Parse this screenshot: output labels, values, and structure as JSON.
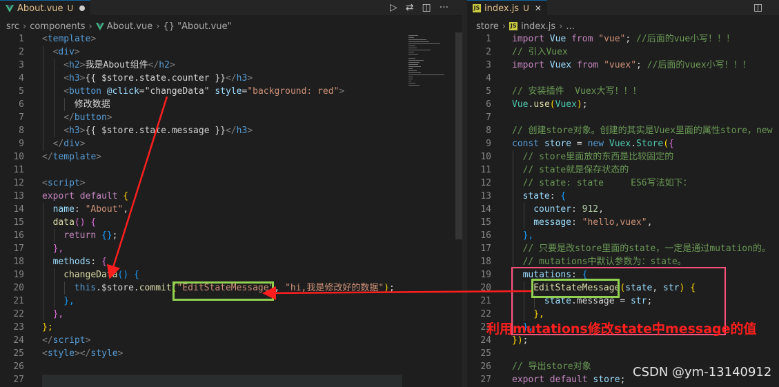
{
  "left": {
    "tab": {
      "label": "About.vue",
      "status": "U"
    },
    "breadcrumb": [
      "src",
      "components",
      "About.vue",
      "{} \"About.vue\""
    ],
    "lines": [
      {
        "n": "1",
        "i": 0,
        "s": [
          [
            "<",
            "k-gray"
          ],
          [
            "template",
            "k-tag"
          ],
          [
            ">",
            "k-gray"
          ]
        ]
      },
      {
        "n": "2",
        "i": 1,
        "s": [
          [
            "<",
            "k-gray"
          ],
          [
            "div",
            "k-tag"
          ],
          [
            ">",
            "k-gray"
          ]
        ]
      },
      {
        "n": "3",
        "i": 2,
        "s": [
          [
            "<",
            "k-gray"
          ],
          [
            "h2",
            "k-tag"
          ],
          [
            ">",
            "k-gray"
          ],
          [
            "我是About组件",
            "k-txt"
          ],
          [
            "</",
            "k-gray"
          ],
          [
            "h2",
            "k-tag"
          ],
          [
            ">",
            "k-gray"
          ]
        ]
      },
      {
        "n": "4",
        "i": 2,
        "s": [
          [
            "<",
            "k-gray"
          ],
          [
            "h3",
            "k-tag"
          ],
          [
            ">",
            "k-gray"
          ],
          [
            "{{ ",
            "k-txt"
          ],
          [
            "$store.state.counter",
            "k-txt"
          ],
          [
            " }}",
            "k-txt"
          ],
          [
            "</",
            "k-gray"
          ],
          [
            "h3",
            "k-tag"
          ],
          [
            ">",
            "k-gray"
          ]
        ]
      },
      {
        "n": "5",
        "i": 2,
        "s": [
          [
            "<",
            "k-gray"
          ],
          [
            "button",
            "k-tag"
          ],
          [
            " @click",
            "k-var"
          ],
          [
            "=",
            "k-txt"
          ],
          [
            "\"changeData\"",
            "k-txt"
          ],
          [
            " style",
            "k-var"
          ],
          [
            "=",
            "k-txt"
          ],
          [
            "\"background: red\"",
            "k-str"
          ],
          [
            ">",
            "k-gray"
          ]
        ]
      },
      {
        "n": "6",
        "i": 3,
        "s": [
          [
            "修改数据",
            "k-txt"
          ]
        ]
      },
      {
        "n": "7",
        "i": 2,
        "s": [
          [
            "</",
            "k-gray"
          ],
          [
            "button",
            "k-tag"
          ],
          [
            ">",
            "k-gray"
          ]
        ]
      },
      {
        "n": "8",
        "i": 2,
        "s": [
          [
            "<",
            "k-gray"
          ],
          [
            "h3",
            "k-tag"
          ],
          [
            ">",
            "k-gray"
          ],
          [
            "{{ ",
            "k-txt"
          ],
          [
            "$store.state.message",
            "k-txt"
          ],
          [
            " }}",
            "k-txt"
          ],
          [
            "</",
            "k-gray"
          ],
          [
            "h3",
            "k-tag"
          ],
          [
            ">",
            "k-gray"
          ]
        ]
      },
      {
        "n": "9",
        "i": 1,
        "s": [
          [
            "</",
            "k-gray"
          ],
          [
            "div",
            "k-tag"
          ],
          [
            ">",
            "k-gray"
          ]
        ]
      },
      {
        "n": "10",
        "i": 0,
        "s": [
          [
            "</",
            "k-gray"
          ],
          [
            "template",
            "k-tag"
          ],
          [
            ">",
            "k-gray"
          ]
        ]
      },
      {
        "n": "11",
        "i": 0,
        "s": []
      },
      {
        "n": "12",
        "i": 0,
        "s": [
          [
            "<",
            "k-gray"
          ],
          [
            "script",
            "k-tag"
          ],
          [
            ">",
            "k-gray"
          ]
        ]
      },
      {
        "n": "13",
        "i": 0,
        "s": [
          [
            "export",
            "k-ctrl"
          ],
          [
            " ",
            "k-txt"
          ],
          [
            "default",
            "k-ctrl"
          ],
          [
            " ",
            "k-txt"
          ],
          [
            "{",
            "k-b1"
          ]
        ]
      },
      {
        "n": "14",
        "i": 1,
        "s": [
          [
            "name",
            "k-var"
          ],
          [
            ": ",
            "k-txt"
          ],
          [
            "\"About\"",
            "k-str"
          ],
          [
            ",",
            "k-txt"
          ]
        ]
      },
      {
        "n": "15",
        "i": 1,
        "s": [
          [
            "data",
            "k-fn"
          ],
          [
            "()",
            "k-b2"
          ],
          [
            " ",
            "k-txt"
          ],
          [
            "{",
            "k-b2"
          ]
        ]
      },
      {
        "n": "16",
        "i": 2,
        "s": [
          [
            "return",
            "k-ctrl"
          ],
          [
            " ",
            "k-txt"
          ],
          [
            "{}",
            "k-b3"
          ],
          [
            ";",
            "k-txt"
          ]
        ]
      },
      {
        "n": "17",
        "i": 1,
        "s": [
          [
            "},",
            "k-b2"
          ]
        ]
      },
      {
        "n": "18",
        "i": 1,
        "s": [
          [
            "methods",
            "k-var"
          ],
          [
            ": ",
            "k-txt"
          ],
          [
            "{",
            "k-b2"
          ]
        ]
      },
      {
        "n": "19",
        "i": 2,
        "s": [
          [
            "changeData",
            "k-fn"
          ],
          [
            "()",
            "k-b3"
          ],
          [
            " ",
            "k-txt"
          ],
          [
            "{",
            "k-b3"
          ]
        ]
      },
      {
        "n": "20",
        "i": 3,
        "s": [
          [
            "this",
            "k-tag"
          ],
          [
            ".$store.",
            "k-txt"
          ],
          [
            "commit",
            "k-fn"
          ],
          [
            "(",
            "k-b1"
          ],
          [
            "\"EditStateMessage\"",
            "k-str"
          ],
          [
            ", ",
            "k-txt"
          ],
          [
            "\"hi,我是修改好的数据\"",
            "k-str"
          ],
          [
            ")",
            "k-b1"
          ],
          [
            ";",
            "k-txt"
          ]
        ]
      },
      {
        "n": "21",
        "i": 2,
        "s": [
          [
            "},",
            "k-b3"
          ]
        ]
      },
      {
        "n": "22",
        "i": 1,
        "s": [
          [
            "},",
            "k-b2"
          ]
        ]
      },
      {
        "n": "23",
        "i": 0,
        "s": [
          [
            "};",
            "k-b1"
          ]
        ]
      },
      {
        "n": "24",
        "i": 0,
        "s": [
          [
            "</",
            "k-gray"
          ],
          [
            "script",
            "k-tag"
          ],
          [
            ">",
            "k-gray"
          ]
        ]
      },
      {
        "n": "25",
        "i": 0,
        "s": [
          [
            "<",
            "k-gray"
          ],
          [
            "style",
            "k-tag"
          ],
          [
            "></",
            "k-gray"
          ],
          [
            "style",
            "k-tag"
          ],
          [
            ">",
            "k-gray"
          ]
        ]
      },
      {
        "n": "26",
        "i": 0,
        "s": []
      },
      {
        "n": "27",
        "i": 0,
        "s": []
      }
    ]
  },
  "right": {
    "tab": {
      "label": "index.js",
      "status": "U"
    },
    "breadcrumb": [
      "store",
      "index.js",
      "..."
    ],
    "lines": [
      {
        "n": "1",
        "i": 0,
        "s": [
          [
            "import",
            "k-ctrl"
          ],
          [
            " ",
            "k-txt"
          ],
          [
            "Vue",
            "k-var"
          ],
          [
            " ",
            "k-txt"
          ],
          [
            "from",
            "k-ctrl"
          ],
          [
            " ",
            "k-txt"
          ],
          [
            "\"vue\"",
            "k-str"
          ],
          [
            "; ",
            "k-txt"
          ],
          [
            "//后面的vue小写！！！",
            "k-com"
          ]
        ]
      },
      {
        "n": "2",
        "i": 0,
        "s": [
          [
            "// 引入Vuex",
            "k-com"
          ]
        ]
      },
      {
        "n": "3",
        "i": 0,
        "s": [
          [
            "import",
            "k-ctrl"
          ],
          [
            " ",
            "k-txt"
          ],
          [
            "Vuex",
            "k-var"
          ],
          [
            " ",
            "k-txt"
          ],
          [
            "from",
            "k-ctrl"
          ],
          [
            " ",
            "k-txt"
          ],
          [
            "\"vuex\"",
            "k-str"
          ],
          [
            "; ",
            "k-txt"
          ],
          [
            "//后面的vuex小写！！！",
            "k-com"
          ]
        ]
      },
      {
        "n": "4",
        "i": 0,
        "s": []
      },
      {
        "n": "5",
        "i": 0,
        "s": [
          [
            "// 安装插件  Vuex大写！！！",
            "k-com"
          ]
        ]
      },
      {
        "n": "6",
        "i": 0,
        "s": [
          [
            "Vue",
            "k-cls"
          ],
          [
            ".",
            "k-txt"
          ],
          [
            "use",
            "k-fn"
          ],
          [
            "(",
            "k-b1"
          ],
          [
            "Vuex",
            "k-cls"
          ],
          [
            ")",
            "k-b1"
          ],
          [
            ";",
            "k-txt"
          ]
        ]
      },
      {
        "n": "7",
        "i": 0,
        "s": []
      },
      {
        "n": "8",
        "i": 0,
        "s": [
          [
            "// 创建store对象。创建的其实是Vuex里面的属性store，new",
            "k-com"
          ]
        ]
      },
      {
        "n": "9",
        "i": 0,
        "s": [
          [
            "const",
            "k-tag"
          ],
          [
            " ",
            "k-txt"
          ],
          [
            "store",
            "k-var"
          ],
          [
            " = ",
            "k-txt"
          ],
          [
            "new",
            "k-tag"
          ],
          [
            " ",
            "k-txt"
          ],
          [
            "Vuex",
            "k-cls"
          ],
          [
            ".",
            "k-txt"
          ],
          [
            "Store",
            "k-cls"
          ],
          [
            "(",
            "k-b1"
          ],
          [
            "{",
            "k-b2"
          ]
        ]
      },
      {
        "n": "10",
        "i": 1,
        "s": [
          [
            "// store里面放的东西是比较固定的",
            "k-com"
          ]
        ]
      },
      {
        "n": "11",
        "i": 1,
        "s": [
          [
            "// state就是保存状态的",
            "k-com"
          ]
        ]
      },
      {
        "n": "12",
        "i": 1,
        "s": [
          [
            "// state: state     ES6写法如下：",
            "k-com"
          ]
        ]
      },
      {
        "n": "13",
        "i": 1,
        "s": [
          [
            "state",
            "k-var"
          ],
          [
            ": ",
            "k-txt"
          ],
          [
            "{",
            "k-b3"
          ]
        ]
      },
      {
        "n": "14",
        "i": 2,
        "s": [
          [
            "counter",
            "k-var"
          ],
          [
            ": ",
            "k-txt"
          ],
          [
            "912",
            "k-num"
          ],
          [
            ",",
            "k-txt"
          ]
        ]
      },
      {
        "n": "15",
        "i": 2,
        "s": [
          [
            "message",
            "k-var"
          ],
          [
            ": ",
            "k-txt"
          ],
          [
            "\"hello,vuex\"",
            "k-str"
          ],
          [
            ",",
            "k-txt"
          ]
        ]
      },
      {
        "n": "16",
        "i": 1,
        "s": [
          [
            "},",
            "k-b3"
          ]
        ]
      },
      {
        "n": "17",
        "i": 1,
        "s": [
          [
            "// 只要是改store里面的state，一定是通过mutation的。",
            "k-com"
          ]
        ]
      },
      {
        "n": "18",
        "i": 1,
        "s": [
          [
            "// mutations中默认参数为：state。",
            "k-com"
          ]
        ]
      },
      {
        "n": "19",
        "i": 1,
        "s": [
          [
            "mutations",
            "k-var"
          ],
          [
            ": ",
            "k-txt"
          ],
          [
            "{",
            "k-b3"
          ]
        ]
      },
      {
        "n": "20",
        "i": 2,
        "s": [
          [
            "EditStateMessage",
            "k-fn"
          ],
          [
            "(",
            "k-b1"
          ],
          [
            "state",
            "k-var"
          ],
          [
            ", ",
            "k-txt"
          ],
          [
            "str",
            "k-var"
          ],
          [
            ")",
            "k-b1"
          ],
          [
            " ",
            "k-txt"
          ],
          [
            "{",
            "k-b1"
          ]
        ]
      },
      {
        "n": "21",
        "i": 3,
        "s": [
          [
            "state",
            "k-var"
          ],
          [
            ".message = ",
            "k-txt"
          ],
          [
            "str",
            "k-var"
          ],
          [
            ";",
            "k-txt"
          ]
        ]
      },
      {
        "n": "22",
        "i": 2,
        "s": [
          [
            "},",
            "k-b1"
          ]
        ]
      },
      {
        "n": "23",
        "i": 1,
        "s": [
          [
            "},",
            "k-b3"
          ]
        ]
      },
      {
        "n": "24",
        "i": 0,
        "s": [
          [
            "})",
            "k-b1"
          ],
          [
            ";",
            "k-txt"
          ]
        ]
      },
      {
        "n": "25",
        "i": 0,
        "s": []
      },
      {
        "n": "26",
        "i": 0,
        "s": [
          [
            "// 导出store对象",
            "k-com"
          ]
        ]
      },
      {
        "n": "27",
        "i": 0,
        "s": [
          [
            "export",
            "k-ctrl"
          ],
          [
            " ",
            "k-txt"
          ],
          [
            "default",
            "k-ctrl"
          ],
          [
            " ",
            "k-txt"
          ],
          [
            "store",
            "k-var"
          ],
          [
            ";",
            "k-txt"
          ]
        ]
      }
    ]
  },
  "annotation": {
    "text": "利用mutations修改state中message的值",
    "color": "#ff1e1e"
  },
  "watermark": "CSDN @ym-13140912",
  "icons": {
    "left_actions": [
      "run-icon",
      "compare-icon",
      "split-editor-icon",
      "more-icon"
    ],
    "right_actions": [
      "split-editor-icon",
      "more-icon"
    ]
  }
}
